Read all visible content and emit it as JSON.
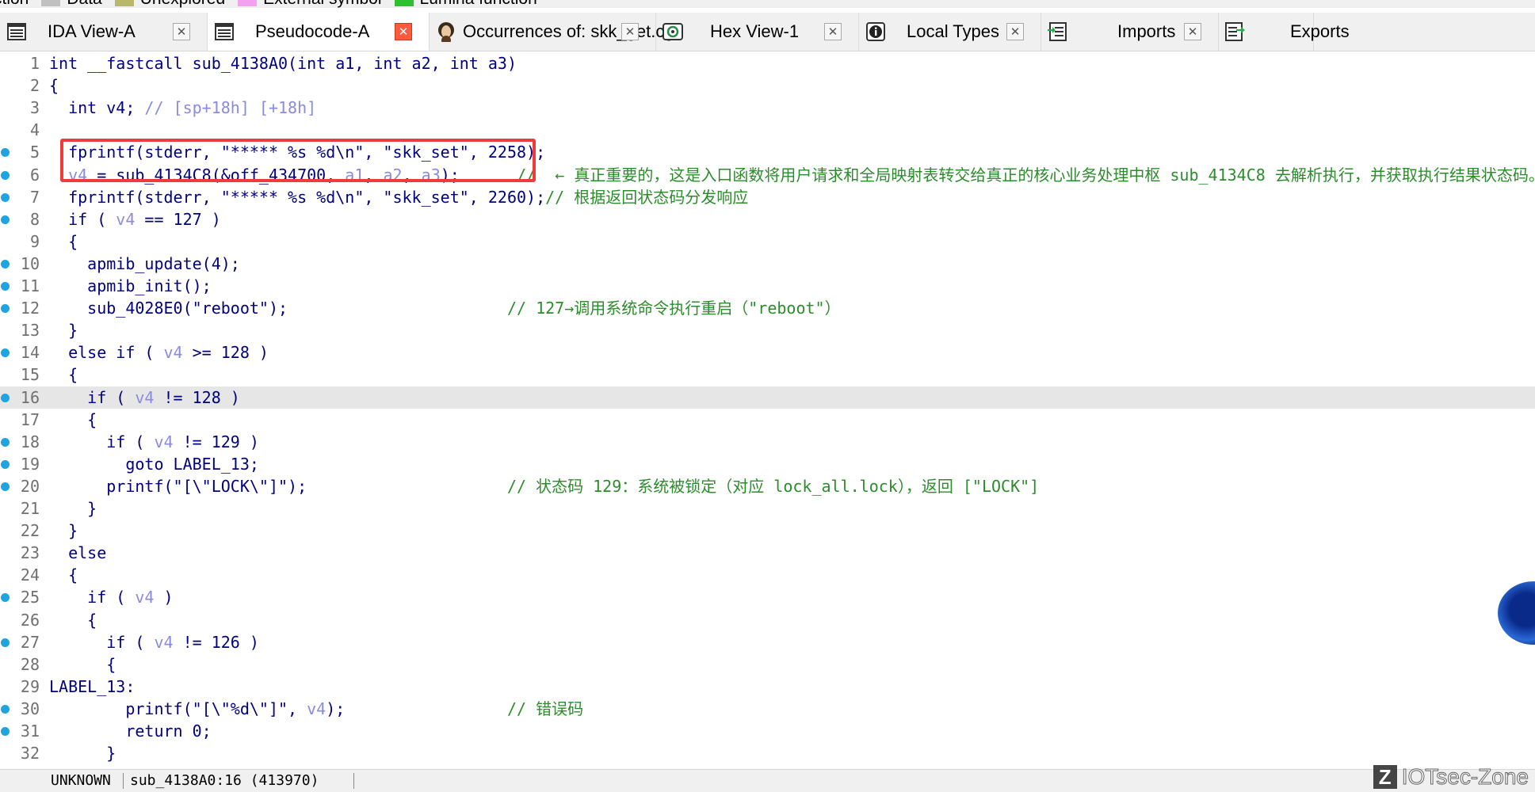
{
  "legend": [
    {
      "label": "ction",
      "color": ""
    },
    {
      "label": "Data",
      "color": "#c0c0c0"
    },
    {
      "label": "Unexplored",
      "color": "#b8b86a"
    },
    {
      "label": "External symbol",
      "color": "#f3a0f0"
    },
    {
      "label": "Lumina function",
      "color": "#2ec02e"
    }
  ],
  "tabs": [
    {
      "label": "IDA View-A",
      "icon": "listing-icon",
      "active": false,
      "closable": true
    },
    {
      "label": "Pseudocode-A",
      "icon": "listing-icon",
      "active": true,
      "closable": true
    },
    {
      "label": "Occurrences of: skk_get.cgi",
      "icon": "avatar-icon",
      "active": false,
      "closable": true
    },
    {
      "label": "Hex View-1",
      "icon": "hex-icon",
      "active": false,
      "closable": true
    },
    {
      "label": "Local Types",
      "icon": "info-icon",
      "active": false,
      "closable": true
    },
    {
      "label": "Imports",
      "icon": "imports-icon",
      "active": false,
      "closable": true
    },
    {
      "label": "Exports",
      "icon": "exports-icon",
      "active": false,
      "closable": false
    }
  ],
  "code_lines": [
    {
      "n": "1",
      "dot": false,
      "hl": false,
      "tokens": [
        [
          "t-kw",
          "int __fastcall sub_4138A0(int a1, int a2, int a3)"
        ]
      ]
    },
    {
      "n": "2",
      "dot": false,
      "hl": false,
      "tokens": [
        [
          "t-pl",
          "{"
        ]
      ]
    },
    {
      "n": "3",
      "dot": false,
      "hl": false,
      "tokens": [
        [
          "t-pl",
          "  int v4; "
        ],
        [
          "t-var",
          "// [sp+18h] [+18h]"
        ]
      ]
    },
    {
      "n": "4",
      "dot": false,
      "hl": false,
      "tokens": []
    },
    {
      "n": "5",
      "dot": true,
      "hl": false,
      "tokens": [
        [
          "t-pl",
          "  fprintf(stderr, \"***** %s %d\\n\", \"skk_set\", 2258);"
        ]
      ]
    },
    {
      "n": "6",
      "dot": true,
      "hl": false,
      "tokens": [
        [
          "t-pl",
          "  "
        ],
        [
          "t-var",
          "v4"
        ],
        [
          "t-pl",
          " = sub_4134C8(&off_434700, "
        ],
        [
          "t-var",
          "a1"
        ],
        [
          "t-pl",
          ", "
        ],
        [
          "t-var",
          "a2"
        ],
        [
          "t-pl",
          ", "
        ],
        [
          "t-var",
          "a3"
        ],
        [
          "t-pl",
          ");      "
        ],
        [
          "t-cm",
          "//  ← 真正重要的，这是入口函数将用户请求和全局映射表转交给真正的核心业务处理中枢 sub_4134C8 去解析执行，并获取执行结果状态码。"
        ]
      ]
    },
    {
      "n": "7",
      "dot": true,
      "hl": false,
      "tokens": [
        [
          "t-pl",
          "  fprintf(stderr, \"***** %s %d\\n\", \"skk_set\", 2260);"
        ],
        [
          "t-cm",
          "// 根据返回状态码分发响应"
        ]
      ]
    },
    {
      "n": "8",
      "dot": true,
      "hl": false,
      "tokens": [
        [
          "t-pl",
          "  if ( "
        ],
        [
          "t-var",
          "v4"
        ],
        [
          "t-pl",
          " == 127 )"
        ]
      ]
    },
    {
      "n": "9",
      "dot": false,
      "hl": false,
      "tokens": [
        [
          "t-pl",
          "  {"
        ]
      ]
    },
    {
      "n": "10",
      "dot": true,
      "hl": false,
      "tokens": [
        [
          "t-pl",
          "    apmib_update(4);"
        ]
      ]
    },
    {
      "n": "11",
      "dot": true,
      "hl": false,
      "tokens": [
        [
          "t-pl",
          "    apmib_init();"
        ]
      ]
    },
    {
      "n": "12",
      "dot": true,
      "hl": false,
      "tokens": [
        [
          "t-pl",
          "    sub_4028E0(\"reboot\");                       "
        ],
        [
          "t-cm",
          "// 127→调用系统命令执行重启（\"reboot\"）"
        ]
      ]
    },
    {
      "n": "13",
      "dot": false,
      "hl": false,
      "tokens": [
        [
          "t-pl",
          "  }"
        ]
      ]
    },
    {
      "n": "14",
      "dot": true,
      "hl": false,
      "tokens": [
        [
          "t-pl",
          "  else if ( "
        ],
        [
          "t-var",
          "v4"
        ],
        [
          "t-pl",
          " >= 128 )"
        ]
      ]
    },
    {
      "n": "15",
      "dot": false,
      "hl": false,
      "tokens": [
        [
          "t-pl",
          "  {"
        ]
      ]
    },
    {
      "n": "16",
      "dot": true,
      "hl": true,
      "tokens": [
        [
          "t-pl",
          "    if ( "
        ],
        [
          "t-var",
          "v4"
        ],
        [
          "t-pl",
          " != 128 )"
        ]
      ]
    },
    {
      "n": "17",
      "dot": false,
      "hl": false,
      "tokens": [
        [
          "t-pl",
          "    {"
        ]
      ]
    },
    {
      "n": "18",
      "dot": true,
      "hl": false,
      "tokens": [
        [
          "t-pl",
          "      if ( "
        ],
        [
          "t-var",
          "v4"
        ],
        [
          "t-pl",
          " != 129 )"
        ]
      ]
    },
    {
      "n": "19",
      "dot": true,
      "hl": false,
      "tokens": [
        [
          "t-pl",
          "        goto LABEL_13;"
        ]
      ]
    },
    {
      "n": "20",
      "dot": true,
      "hl": false,
      "tokens": [
        [
          "t-pl",
          "      printf(\"[\\\"LOCK\\\"]\");                     "
        ],
        [
          "t-cm",
          "// 状态码 129：系统被锁定（对应 lock_all.lock），返回 [\"LOCK\"]"
        ]
      ]
    },
    {
      "n": "21",
      "dot": false,
      "hl": false,
      "tokens": [
        [
          "t-pl",
          "    }"
        ]
      ]
    },
    {
      "n": "22",
      "dot": false,
      "hl": false,
      "tokens": [
        [
          "t-pl",
          "  }"
        ]
      ]
    },
    {
      "n": "23",
      "dot": false,
      "hl": false,
      "tokens": [
        [
          "t-pl",
          "  else"
        ]
      ]
    },
    {
      "n": "24",
      "dot": false,
      "hl": false,
      "tokens": [
        [
          "t-pl",
          "  {"
        ]
      ]
    },
    {
      "n": "25",
      "dot": true,
      "hl": false,
      "tokens": [
        [
          "t-pl",
          "    if ( "
        ],
        [
          "t-var",
          "v4"
        ],
        [
          "t-pl",
          " )"
        ]
      ]
    },
    {
      "n": "26",
      "dot": false,
      "hl": false,
      "tokens": [
        [
          "t-pl",
          "    {"
        ]
      ]
    },
    {
      "n": "27",
      "dot": true,
      "hl": false,
      "tokens": [
        [
          "t-pl",
          "      if ( "
        ],
        [
          "t-var",
          "v4"
        ],
        [
          "t-pl",
          " != 126 )"
        ]
      ]
    },
    {
      "n": "28",
      "dot": false,
      "hl": false,
      "tokens": [
        [
          "t-pl",
          "      {"
        ]
      ]
    },
    {
      "n": "29",
      "dot": false,
      "hl": false,
      "tokens": [
        [
          "t-lbl",
          "LABEL_13:"
        ]
      ]
    },
    {
      "n": "30",
      "dot": true,
      "hl": false,
      "tokens": [
        [
          "t-pl",
          "        printf(\"[\\\"%d\\\"]\", "
        ],
        [
          "t-var",
          "v4"
        ],
        [
          "t-pl",
          ");                 "
        ],
        [
          "t-cm",
          "// 错误码"
        ]
      ]
    },
    {
      "n": "31",
      "dot": true,
      "hl": false,
      "tokens": [
        [
          "t-pl",
          "        return 0;"
        ]
      ]
    },
    {
      "n": "32",
      "dot": false,
      "hl": false,
      "tokens": [
        [
          "t-pl",
          "      }"
        ]
      ]
    }
  ],
  "status": {
    "segment": "UNKNOWN",
    "location": "sub_4138A0:16 (413970)"
  },
  "watermark": {
    "logo": "Z",
    "text": "IOTsec-Zone"
  }
}
